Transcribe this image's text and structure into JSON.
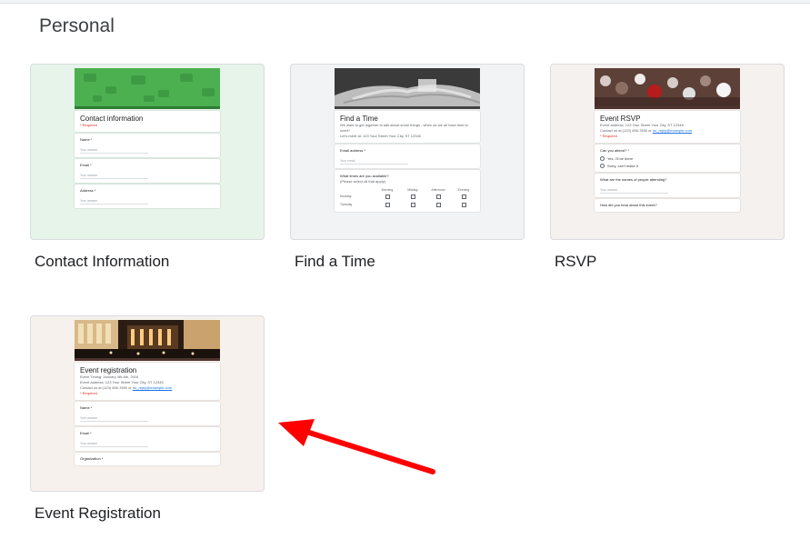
{
  "section": {
    "title": "Personal"
  },
  "templates": [
    {
      "label": "Contact Information",
      "bg": "#e6f4ea",
      "accent": "#4caf50",
      "form_title": "Contact information",
      "required_note": "* Required",
      "questions": [
        "Name *",
        "Email *",
        "Address *"
      ],
      "answer_placeholder": "Your answer"
    },
    {
      "label": "Find a Time",
      "bg": "#f1f3f4",
      "accent": "#424242",
      "form_title": "Find a Time",
      "desc_lines": [
        "We want to get together to talk about some things - when do we all have time to meet?",
        "Let's meet at: 123 Your Street Your City, ST 12345"
      ],
      "email_q": "Email address *",
      "answer_placeholder": "Your email",
      "grid_q": "What times are you available?",
      "grid_note": "(Please select all that apply)",
      "grid_cols": [
        "Morning",
        "Midday",
        "Afternoon",
        "Evening"
      ],
      "grid_rows": [
        "Monday",
        "Tuesday"
      ]
    },
    {
      "label": "RSVP",
      "bg": "#f5f1ee",
      "accent": "#4e342e",
      "form_title": "Event RSVP",
      "desc_lines": [
        "Event address: 123 Your Street Your City, ST 12345",
        "Contact us at (123) 456-7890 or"
      ],
      "email_link": "no_reply@example.com",
      "required_note": "* Required",
      "attend_q": "Can you attend? *",
      "options": [
        "Yes, I'll be there",
        "Sorry, can't make it"
      ],
      "names_q": "What are the names of people attending?",
      "answer_placeholder": "Your answer",
      "hear_q": "How did you hear about this event?"
    },
    {
      "label": "Event Registration",
      "bg": "#f7f1ed",
      "accent": "#4e342e",
      "form_title": "Event registration",
      "desc_lines": [
        "Event Timing: January 4th-6th, 2016",
        "Event address: 123 Your Street Your City, ST 12345",
        "Contact us at (123) 456-7890 or"
      ],
      "email_link": "no_reply@example.com",
      "required_note": "* Required",
      "questions": [
        "Name *",
        "Email *",
        "Organization *"
      ],
      "answer_placeholder": "Your answer"
    }
  ],
  "annotation": {
    "arrow_color": "#ff0000"
  }
}
